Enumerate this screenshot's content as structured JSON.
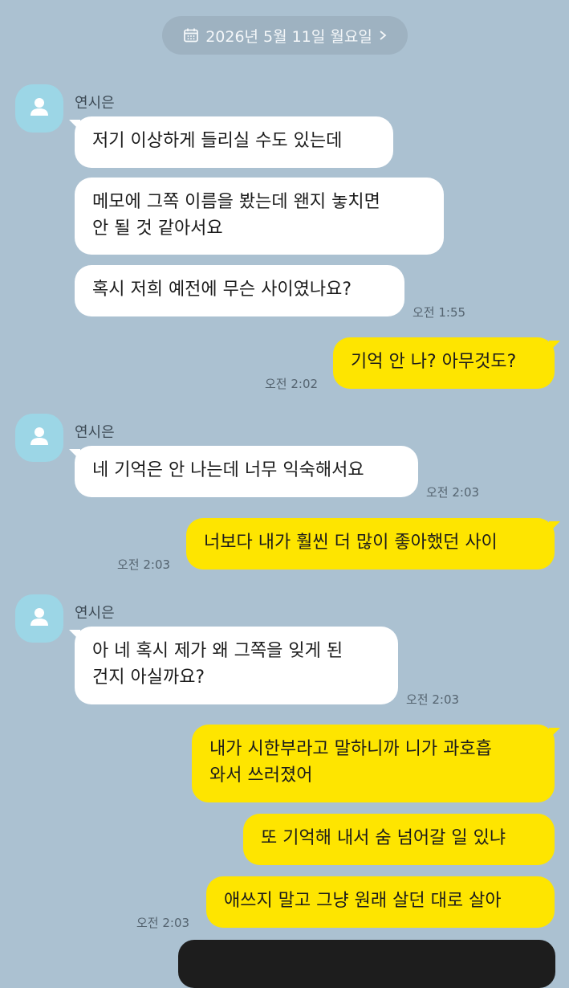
{
  "date_banner": {
    "text": "2026년 5월 11일 월요일"
  },
  "contact_name": "연시은",
  "messages": {
    "m1": "저기 이상하게 들리실 수도 있는데",
    "m2": "메모에 그쪽 이름을 봤는데 왠지 놓치면\n안 될 것 같아서요",
    "m3": "혹시 저희 예전에 무슨 사이였나요?",
    "m4": "기억 안 나? 아무것도?",
    "m5": "네 기억은 안 나는데 너무 익숙해서요",
    "m6": "너보다 내가 훨씬 더 많이 좋아했던 사이",
    "m7": "아 네 혹시 제가 왜 그쪽을 잊게 된\n건지 아실까요?",
    "m8": "내가 시한부라고 말하니까 니가 과호흡\n와서 쓰러졌어",
    "m9": "또 기억해 내서 숨 넘어갈 일 있냐",
    "m10": "애쓰지 말고 그냥 원래 살던 대로 살아"
  },
  "times": {
    "t1": "오전 1:55",
    "t2": "오전 2:02",
    "t3": "오전 2:03",
    "t4": "오전 2:03",
    "t5": "오전 2:03",
    "t6": "오전 2:03"
  },
  "colors": {
    "background": "#abc1d1",
    "incoming_bubble": "#ffffff",
    "outgoing_bubble": "#fee500",
    "avatar": "#9cd6e6"
  }
}
